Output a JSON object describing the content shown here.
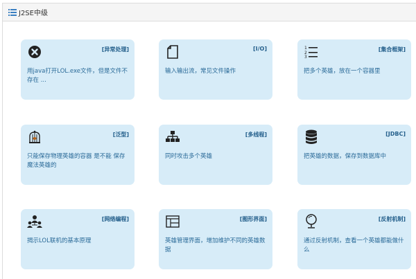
{
  "panel": {
    "title": "J2SE中级"
  },
  "cards": [
    {
      "tag": "[异常处理]",
      "desc": "用java打开LOL.exe文件，但是文件不存在 ..."
    },
    {
      "tag": "[I/O]",
      "desc": "输入输出流，常见文件操作"
    },
    {
      "tag": "[集合框架]",
      "desc": "把多个英雄，放在一个容器里"
    },
    {
      "tag": "[泛型]",
      "desc": "只能保存物理英雄的容器 是不能 保存魔法英雄的"
    },
    {
      "tag": "[多线程]",
      "desc": "同时攻击多个英雄"
    },
    {
      "tag": "[JDBC]",
      "desc": "把英雄的数据，保存到数据库中"
    },
    {
      "tag": "[网络编程]",
      "desc": "揭示LOL联机的基本原理"
    },
    {
      "tag": "[图形界面]",
      "desc": "英雄管理界面，增加维护不同的英雄数据"
    },
    {
      "tag": "[反射机制]",
      "desc": "通过反射机制，查看一个英雄都能做什么"
    }
  ]
}
